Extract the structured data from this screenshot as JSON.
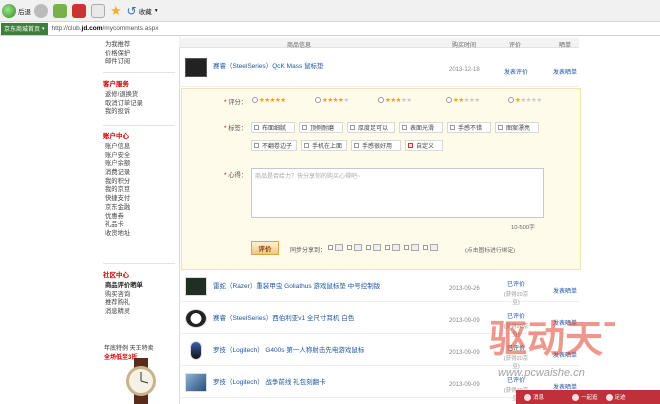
{
  "browser": {
    "toolbar": {
      "back_label": "后退",
      "favorites_label": "收藏"
    },
    "address": {
      "site_tag": "京东商城首页",
      "url_prefix": "http://club.",
      "url_domain": "jd.com",
      "url_path": "/mycomments.aspx"
    }
  },
  "sidebar": {
    "group_top": {
      "items": [
        "为我推荐",
        "价格保护",
        "邮件订阅"
      ]
    },
    "group_service": {
      "heading": "客户服务",
      "items": [
        "返修/退换货",
        "取消订单记录",
        "我的投诉"
      ]
    },
    "group_account": {
      "heading": "账户中心",
      "items": [
        "账户信息",
        "账户安全",
        "账户余额",
        "消费记录",
        "我的积分",
        "我的京豆",
        "快捷支付",
        "京东金融",
        "优惠券",
        "礼品卡",
        "收货地址"
      ]
    },
    "group_community": {
      "heading": "社区中心",
      "items": [
        "商品评价晒单",
        "购买咨询",
        "推荐购礼",
        "消息精灵"
      ],
      "active_index": 0
    },
    "ad": {
      "line1": "年底特例 天王特卖",
      "line2": "全场低至3折"
    }
  },
  "main": {
    "columns": {
      "product": "商品信息",
      "date": "购买时间",
      "review": "评价",
      "show": "晒单"
    },
    "first_row": {
      "name": "赛睿（SteelSeries）QcK Mass 鼠标垫",
      "date": "2013-12-18",
      "status": "发表评价",
      "show": "发表晒单"
    },
    "review_form": {
      "score_label": "评分：",
      "tags_label": "标签：",
      "heart_label": "心得：",
      "score_options": [
        5,
        4,
        3,
        2,
        1
      ],
      "tags": [
        "布面细腻",
        "顶侧耐磨",
        "厚度足可以",
        "表面光滑",
        "手感不错",
        "图案漂亮",
        "不翻卷边子",
        "手机在上面",
        "手感很好用",
        "自定义"
      ],
      "heart_placeholder": "商品是否给力？快分享你的购买心得吧~",
      "count_hint": "10-500字",
      "submit_label": "评价",
      "share_label": "同步分享到：",
      "share_hint": "(点击图标进行绑定)"
    },
    "rows": [
      {
        "name": "雷蛇（Razer）重装甲虫 Goliathus 游戏鼠标垫 中号控制版",
        "date": "2013-09-26",
        "status": "已评价",
        "status_sub": "(获得20京豆)",
        "show": "发表晒单"
      },
      {
        "name": "赛睿（SteelSeries）西伯利亚v1 全尺寸耳机 白色",
        "date": "2013-09-09",
        "status": "已评价",
        "status_sub": "(获得20京豆)",
        "show": "发表晒单"
      },
      {
        "name": "罗技（Logitech） G400s 第一人称射击先电游戏鼠标",
        "date": "2013-09-09",
        "status": "已评价",
        "status_sub": "(获得20京豆)",
        "show": "发表晒单"
      },
      {
        "name": "罗技（Logitech） 战争前线 礼包刻翻卡",
        "date": "2013-09-09",
        "status": "已评价",
        "status_sub": "(获得20京豆)",
        "show": "发表晒单"
      }
    ]
  },
  "watermark": {
    "text": "驱动天下",
    "url": "www.pcwaishe.cn"
  },
  "float_bar": {
    "items": [
      "消息",
      "一起逛",
      "足迹"
    ]
  }
}
